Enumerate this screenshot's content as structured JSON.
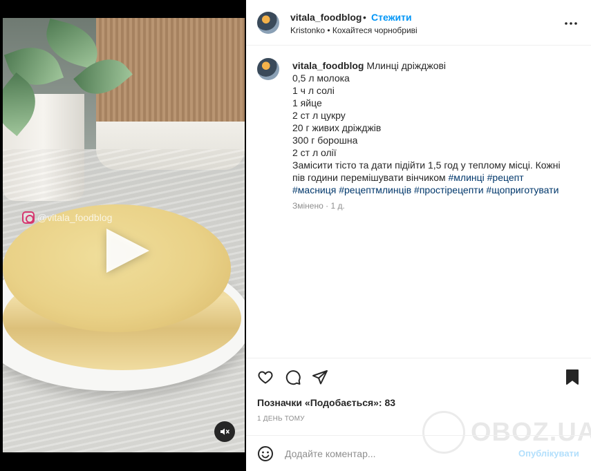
{
  "media": {
    "watermark": "@vitala_foodblog",
    "icons": {
      "play": "play-icon",
      "mute": "speaker-muted-icon",
      "watermark": "instagram-icon"
    }
  },
  "header": {
    "username": "vitala_foodblog",
    "separator": "•",
    "follow_label": "Стежити",
    "audio": "Kristonko • Кохайтеся чорнобриві",
    "more_icon": "more-horizontal-icon"
  },
  "caption": {
    "username": "vitala_foodblog",
    "title": "Млинці дріжджові",
    "lines": [
      "0,5 л молока",
      "1 ч л солі",
      "1 яйце",
      "2 ст л цукру",
      "20 г живих дріжджів",
      "300 г борошна",
      "2 ст л олії"
    ],
    "instructions": "Замісити тісто та дати підійти 1,5 год у теплому місці. Кожні пів години перемішувати вінчиком",
    "hashtags_inline": "#млинці #рецепт",
    "hashtags": "#масниця #рецептмлинців #простірецепти #щоприготувати",
    "edited": "Змінено",
    "dot": "·",
    "age": "1 д."
  },
  "actions": {
    "icons": [
      "heart-icon",
      "comment-icon",
      "share-icon",
      "bookmark-icon"
    ],
    "likes": "Позначки «Подобається»: 83",
    "timestamp": "1 ДЕНЬ ТОМУ"
  },
  "watermark_brand": "OBOZ.UA",
  "comment": {
    "placeholder": "Додайте коментар...",
    "post_label": "Опублікувати"
  },
  "colors": {
    "link": "#0095f6",
    "hashtag": "#00376b",
    "post_disabled": "#b2dffc",
    "text": "#262626",
    "muted": "#8e8e8e"
  }
}
